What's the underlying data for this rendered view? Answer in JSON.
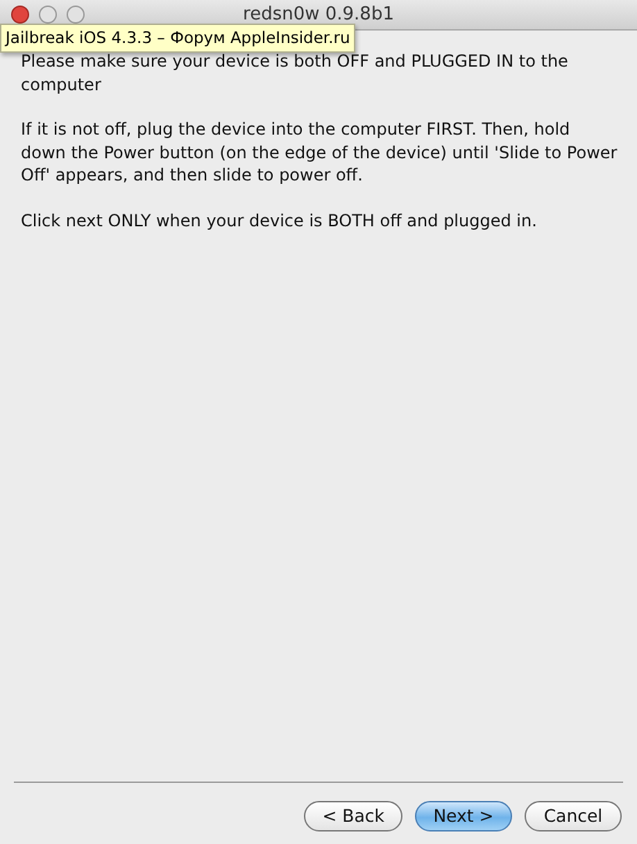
{
  "window": {
    "title": "redsn0w 0.9.8b1"
  },
  "tooltip": "Jailbreak iOS 4.3.3 – Форум AppleInsider.ru",
  "paragraphs": [
    "Please make sure your device is both OFF and PLUGGED IN to the computer",
    "If it is not off, plug the device into the computer FIRST. Then, hold down the Power button (on the edge of the device) until 'Slide to Power Off' appears, and then slide to power off.",
    "Click next ONLY when your device is BOTH off and plugged in."
  ],
  "buttons": [
    {
      "label": "< Back",
      "default": false
    },
    {
      "label": "Next >",
      "default": true
    },
    {
      "label": "Cancel",
      "default": false
    }
  ]
}
